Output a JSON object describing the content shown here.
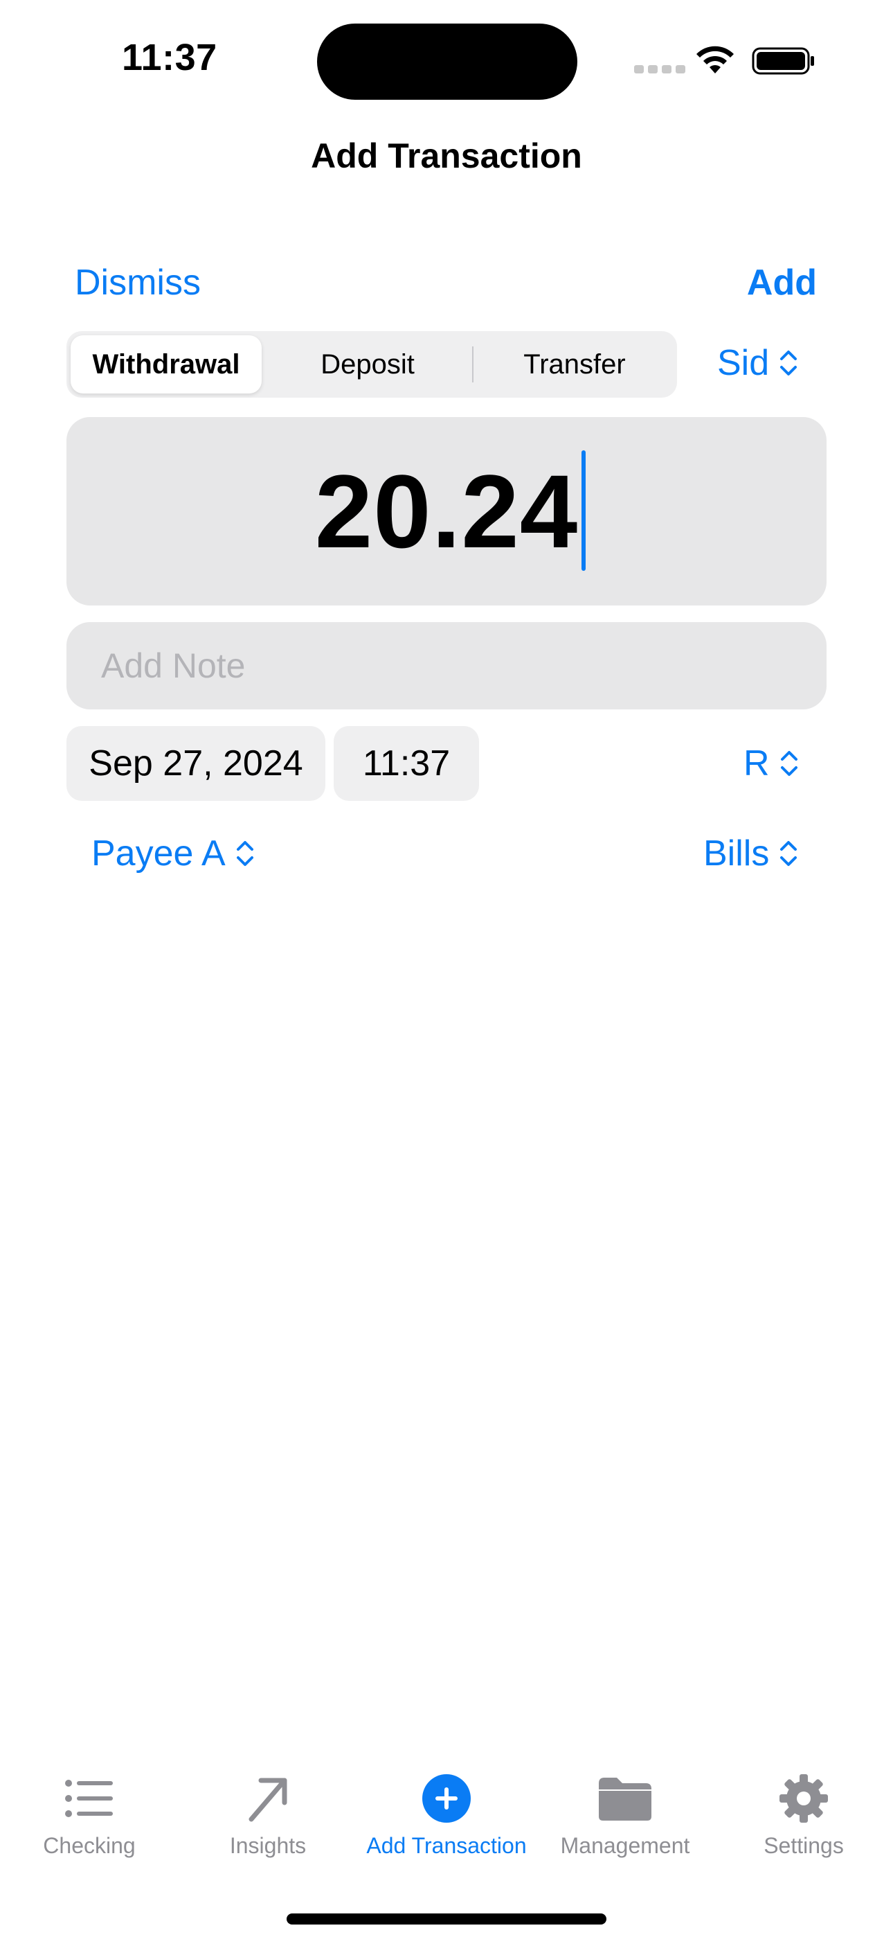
{
  "status_bar": {
    "time": "11:37"
  },
  "nav": {
    "title": "Add Transaction",
    "dismiss_label": "Dismiss",
    "add_label": "Add"
  },
  "type_segment": {
    "options": [
      "Withdrawal",
      "Deposit",
      "Transfer"
    ],
    "selected": "Withdrawal"
  },
  "account_picker": {
    "value": "Sid"
  },
  "amount": {
    "value": "20.24"
  },
  "note": {
    "placeholder": "Add Note"
  },
  "date_time": {
    "date": "Sep 27, 2024",
    "time": "11:37"
  },
  "reconcile_picker": {
    "value": "R"
  },
  "payee_picker": {
    "value": "Payee A"
  },
  "category_picker": {
    "value": "Bills"
  },
  "tab_bar": {
    "items": [
      {
        "label": "Checking",
        "icon": "list-icon"
      },
      {
        "label": "Insights",
        "icon": "arrow-up-right-icon"
      },
      {
        "label": "Add Transaction",
        "icon": "plus-circle-icon"
      },
      {
        "label": "Management",
        "icon": "folder-icon"
      },
      {
        "label": "Settings",
        "icon": "gear-icon"
      }
    ],
    "active": "Add Transaction"
  },
  "colors": {
    "accent": "#0a7cf4",
    "field_background": "#e7e7e8",
    "inactive_tab": "#8e8e93"
  }
}
